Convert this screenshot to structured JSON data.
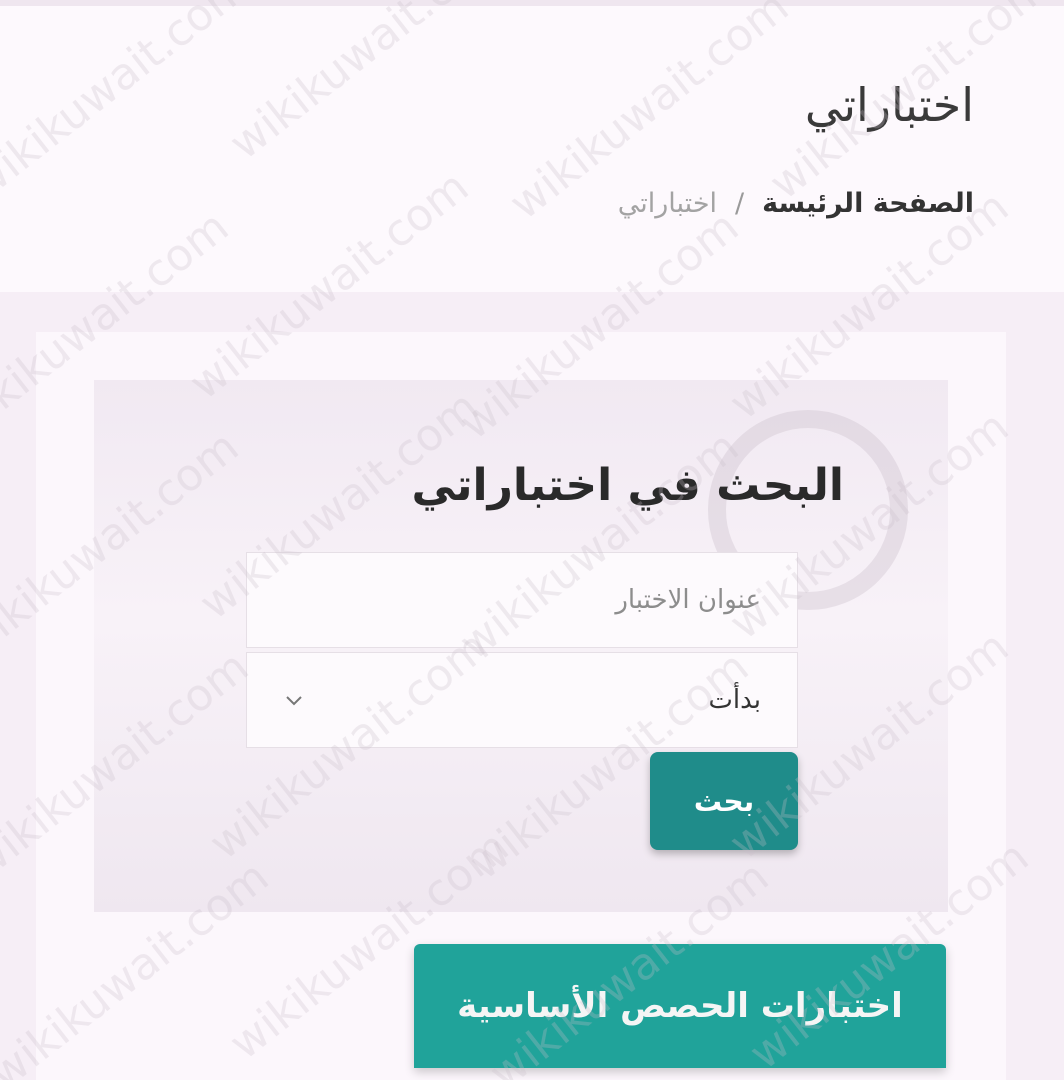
{
  "header": {
    "title": "اختباراتي",
    "breadcrumb": {
      "home": "الصفحة الرئيسة",
      "separator": "/",
      "current": "اختباراتي"
    }
  },
  "search": {
    "title": "البحث في اختباراتي",
    "title_placeholder": "عنوان الاختبار",
    "status_value": "بدأت",
    "button_label": "بحث"
  },
  "category_button_label": "اختبارات الحصص الأساسية",
  "watermark": "wikikuwait.com",
  "colors": {
    "search_button": "#1f8c8a",
    "category_button": "#20a39a",
    "background": "#fcf8fc"
  }
}
